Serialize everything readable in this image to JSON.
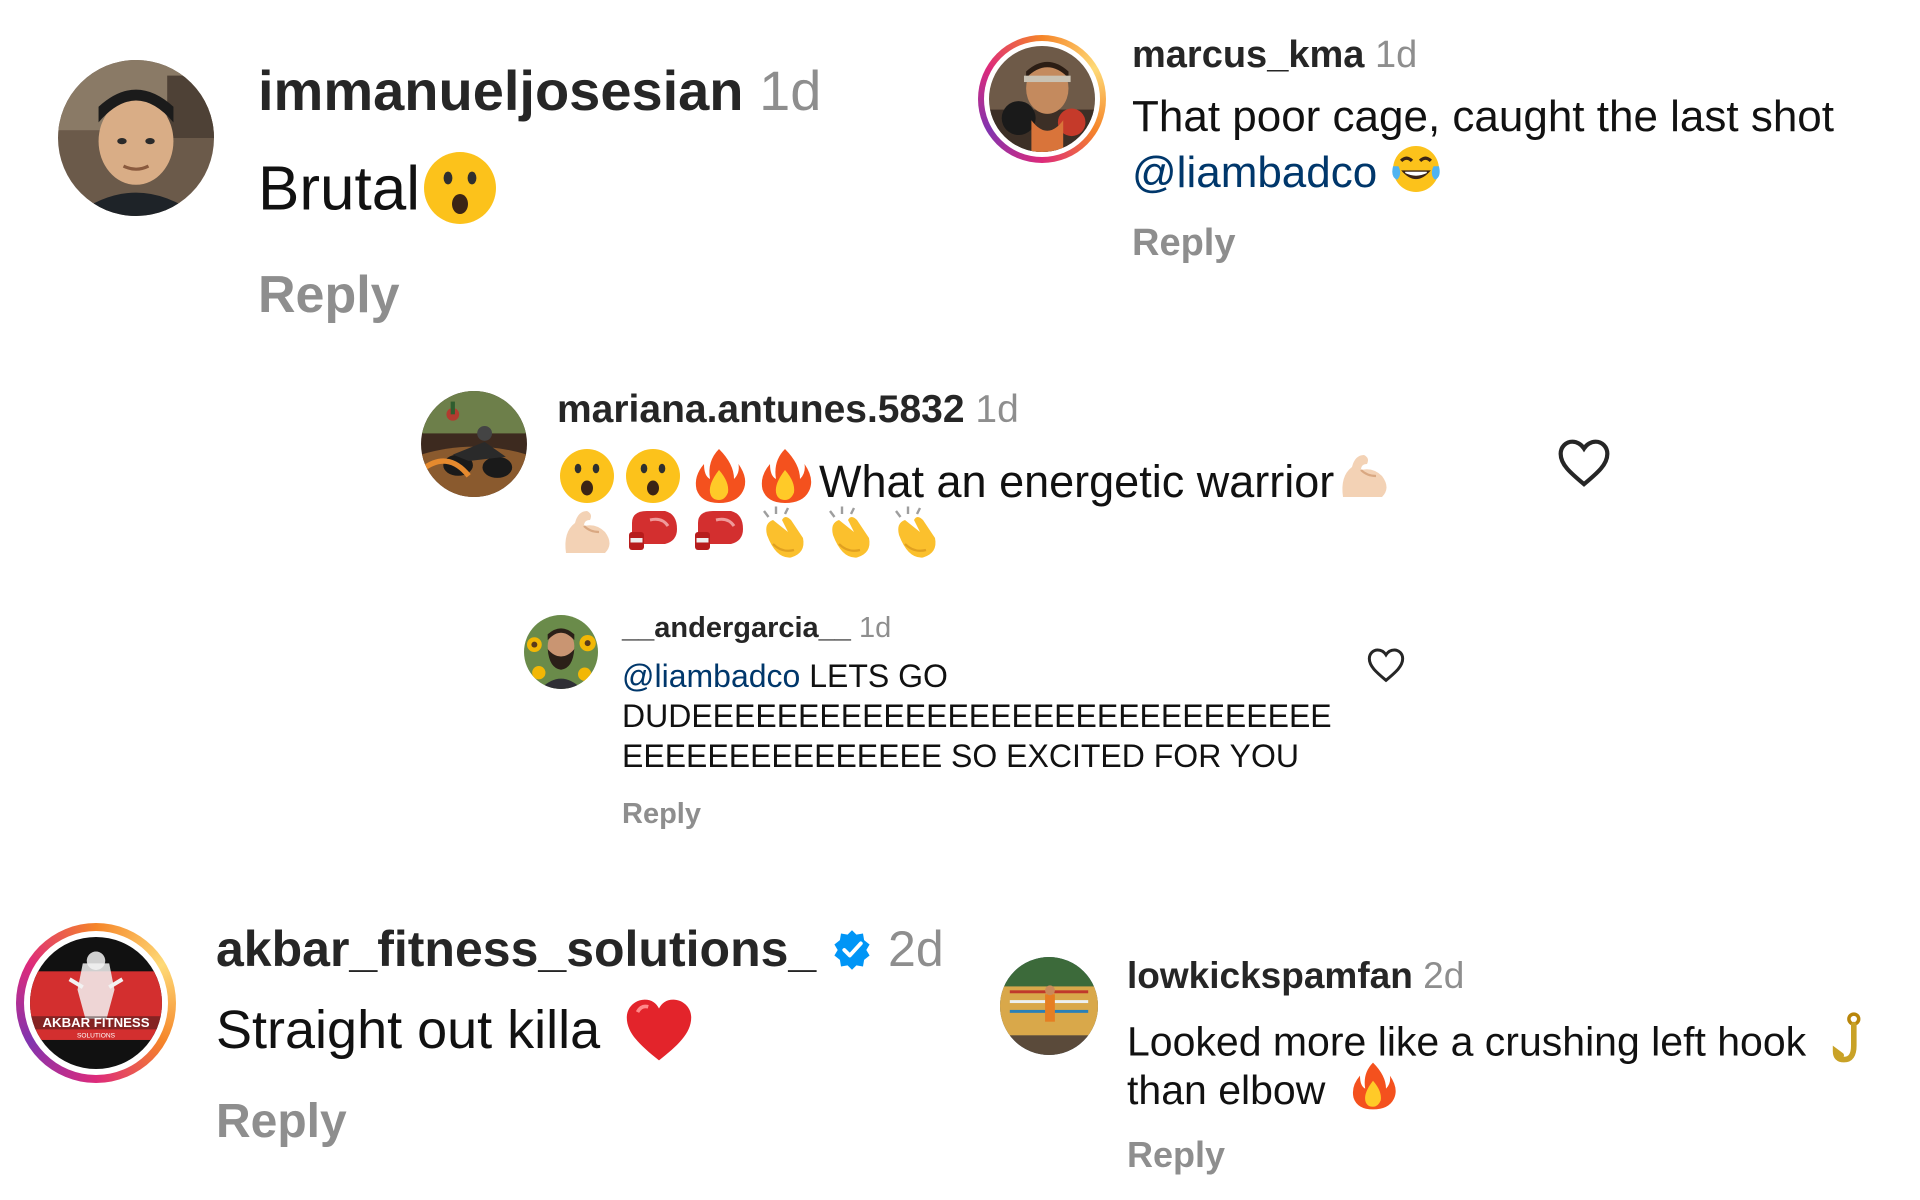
{
  "comments": [
    {
      "username": "immanueljosesian",
      "time": "1d",
      "text": "Brutal",
      "emojis": [
        "astonished-face-emoji"
      ],
      "reply_label": "Reply"
    },
    {
      "username": "marcus_kma",
      "time": "1d",
      "text": "That poor cage, caught the last shot",
      "mention": "@liambadco",
      "emojis": [
        "tears-of-joy-emoji"
      ],
      "reply_label": "Reply"
    },
    {
      "username": "mariana.antunes.5832",
      "time": "1d",
      "text": "What an energetic warrior",
      "emojis_before": [
        "astonished-face-emoji",
        "astonished-face-emoji",
        "fire-emoji",
        "fire-emoji"
      ],
      "emojis_after": [
        "flexed-biceps-emoji"
      ],
      "emojis_line2": [
        "flexed-biceps-emoji",
        "boxing-glove-emoji",
        "boxing-glove-emoji",
        "clapping-hands-emoji",
        "clapping-hands-emoji",
        "clapping-hands-emoji"
      ],
      "like_icon": "heart-outline-icon"
    },
    {
      "username": "__andergarcia__",
      "time": "1d",
      "mention": "@liambadco",
      "text": "LETS GO",
      "text_line2": "DUDEEEEEEEEEEEEEEEEEEEEEEEEEEEEEE",
      "text_line3": "EEEEEEEEEEEEEEE SO EXCITED FOR YOU",
      "reply_label": "Reply",
      "like_icon": "heart-outline-icon"
    },
    {
      "username": "akbar_fitness_solutions_",
      "verified": true,
      "time": "2d",
      "text": "Straight out killa",
      "emojis": [
        "red-heart-emoji"
      ],
      "reply_label": "Reply",
      "avatar_text": "AKBAR FITNESS",
      "avatar_subtext": "SOLUTIONS"
    },
    {
      "username": "lowkickspamfan",
      "time": "2d",
      "text": "Looked more like a crushing left hook",
      "text_line2": "than elbow",
      "emojis": [
        "hook-emoji"
      ],
      "emojis_line2": [
        "fire-emoji"
      ],
      "reply_label": "Reply"
    }
  ],
  "colors": {
    "username": "#262626",
    "muted": "#8e8e8e",
    "mention": "#00376b",
    "verified": "#0095f6",
    "story_ring": [
      "#f58529",
      "#dd2a7b",
      "#8134af",
      "#feda77"
    ]
  }
}
